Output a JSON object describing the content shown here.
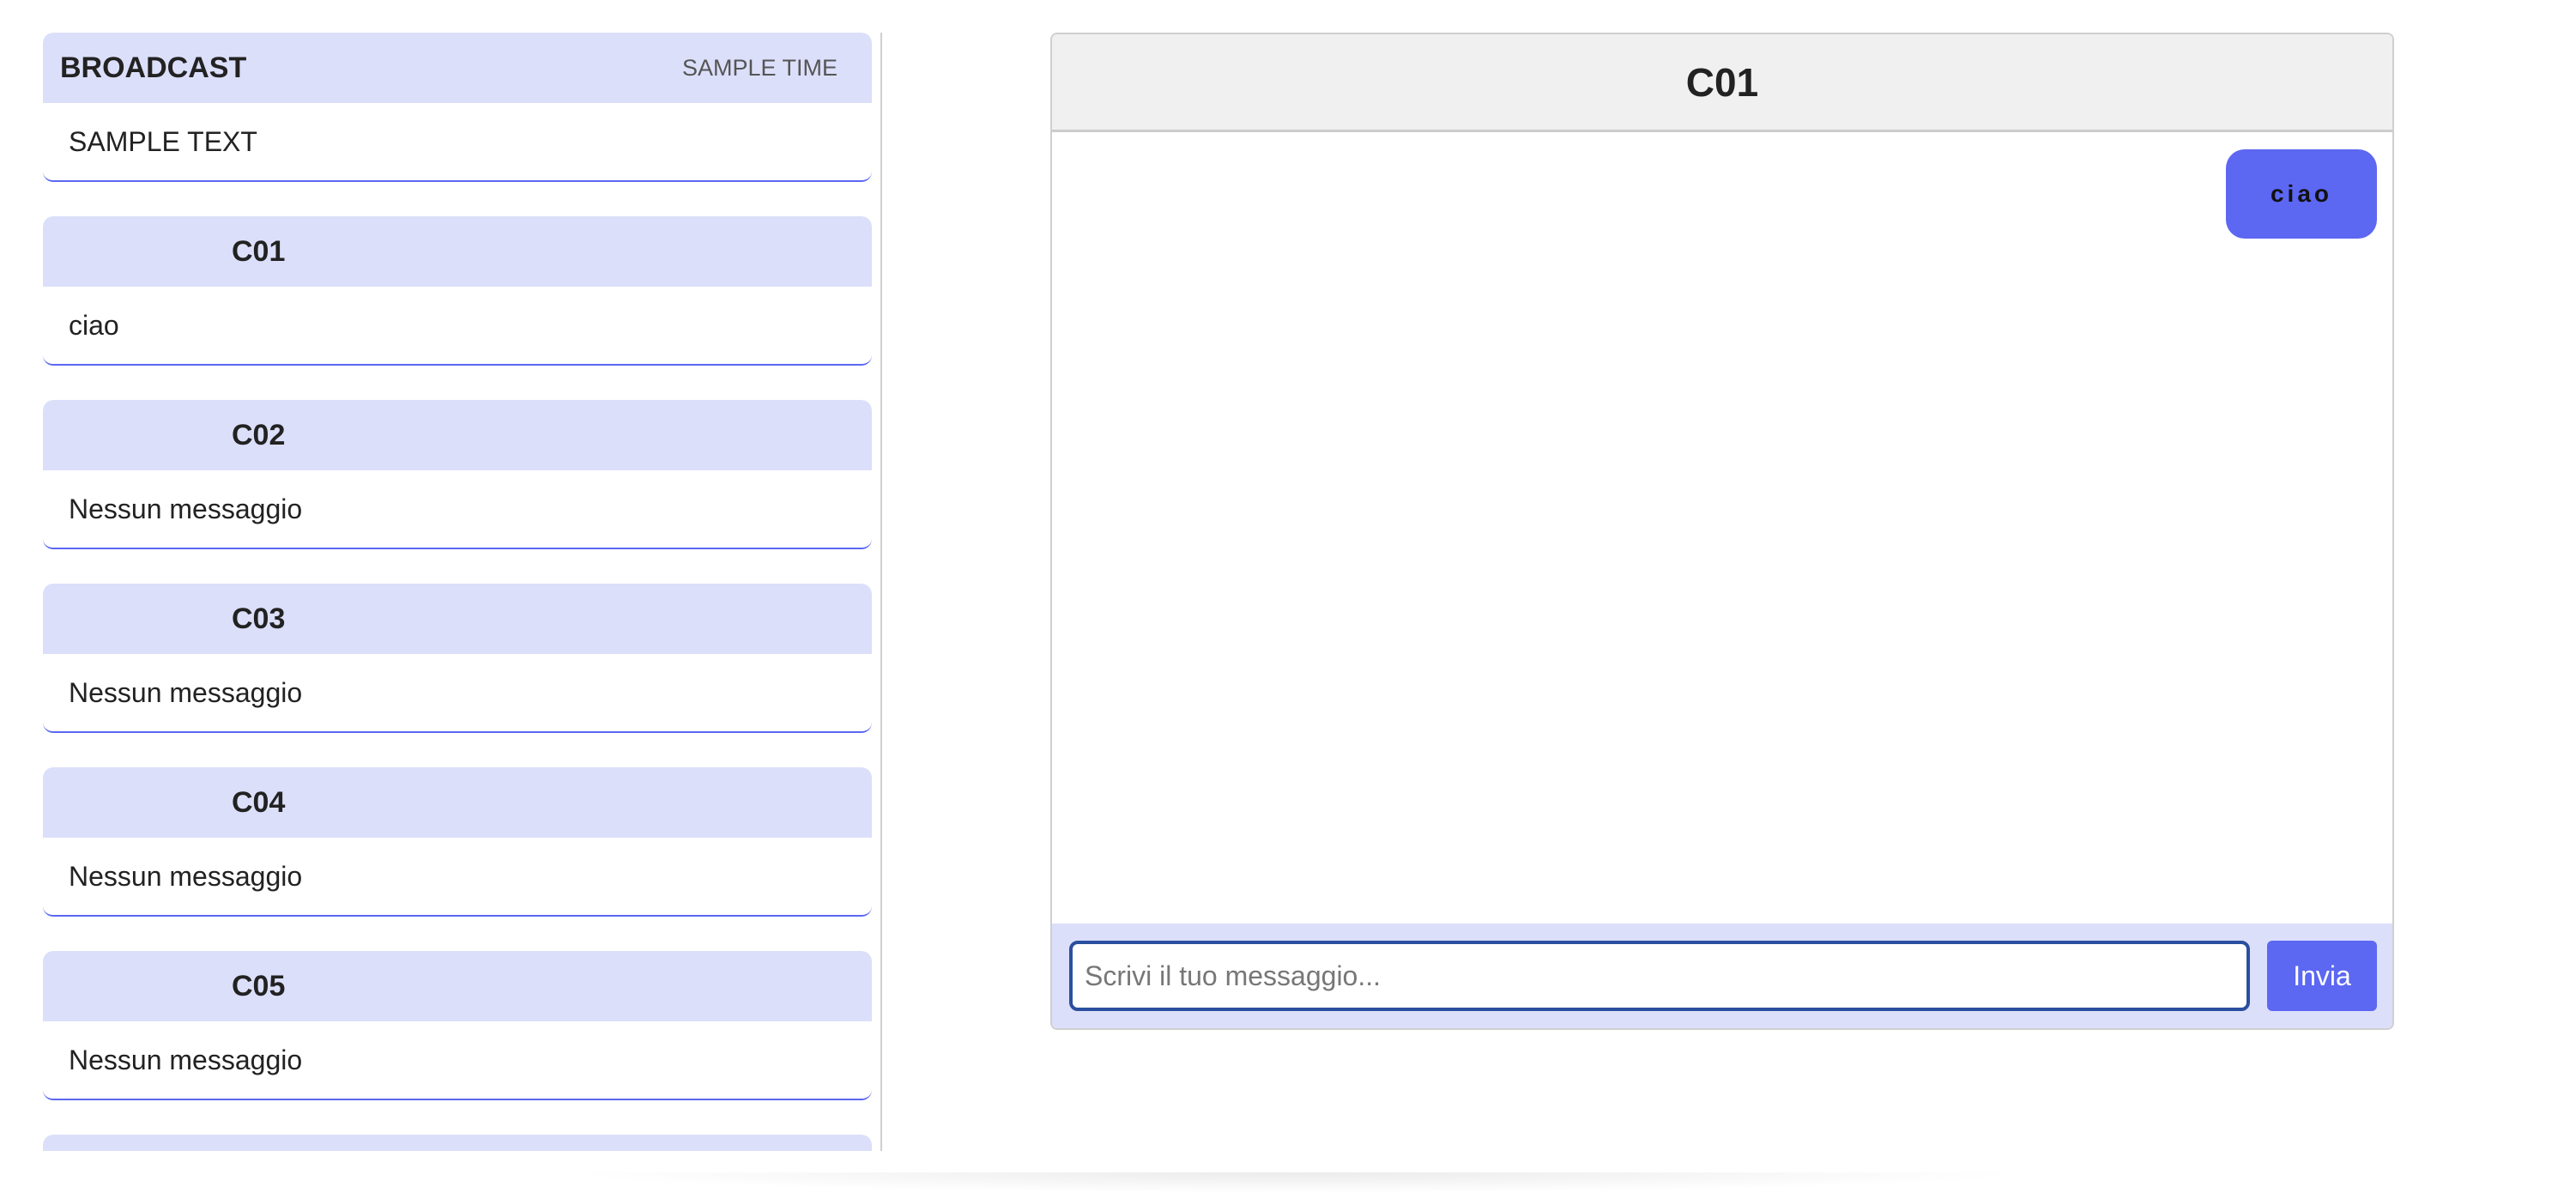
{
  "sidebar": {
    "broadcast": {
      "name": "BROADCAST",
      "time": "SAMPLE TIME",
      "text": "SAMPLE TEXT"
    },
    "chats": [
      {
        "name": "C01",
        "last_message": "ciao"
      },
      {
        "name": "C02",
        "last_message": "Nessun messaggio"
      },
      {
        "name": "C03",
        "last_message": "Nessun messaggio"
      },
      {
        "name": "C04",
        "last_message": "Nessun messaggio"
      },
      {
        "name": "C05",
        "last_message": "Nessun messaggio"
      }
    ]
  },
  "chat": {
    "title": "C01",
    "messages": [
      {
        "text": "ciao",
        "sent": true
      }
    ],
    "input": {
      "placeholder": "Scrivi il tuo messaggio...",
      "value": ""
    },
    "send_label": "Invia"
  },
  "colors": {
    "accent": "#5c67f2",
    "card_header_bg": "#dcdffa",
    "chat_header_bg": "#f0f0f0",
    "input_border": "#2a4f9e"
  }
}
